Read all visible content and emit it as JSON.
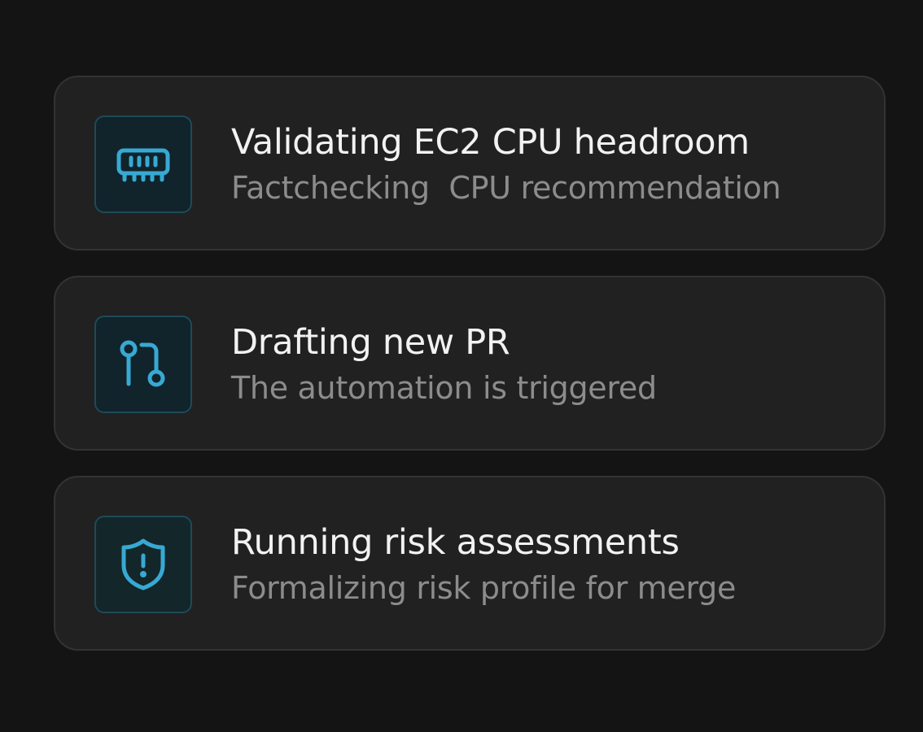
{
  "theme": {
    "background": "#141414",
    "card_background": "#212121",
    "card_border": "#333333",
    "accent": "#37a9d3",
    "title_color": "#f2f2f2",
    "subtitle_color": "#8c8c8c"
  },
  "tasks": [
    {
      "icon": "memory-chip-icon",
      "title": "Validating EC2 CPU headroom",
      "subtitle": "Factchecking  CPU recommendation"
    },
    {
      "icon": "git-pull-request-icon",
      "title": "Drafting new PR",
      "subtitle": "The automation is triggered"
    },
    {
      "icon": "shield-alert-icon",
      "title": "Running risk assessments",
      "subtitle": "Formalizing risk profile for merge"
    }
  ]
}
